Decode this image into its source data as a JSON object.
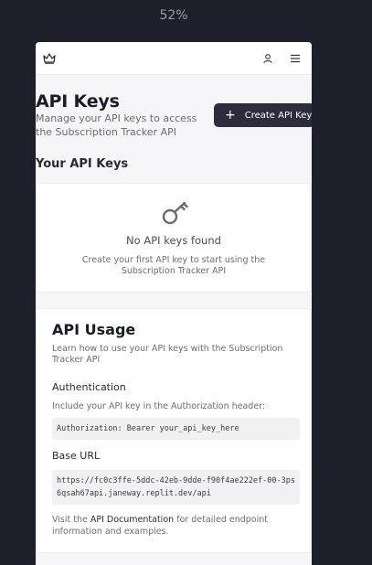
{
  "zoom": "52%",
  "page": {
    "title": "API Keys",
    "subtitle": "Manage your API keys to access the Subscription Tracker API",
    "create_button": "Create API Key"
  },
  "your_keys": {
    "heading": "Your API Keys",
    "empty_title": "No API keys found",
    "empty_desc": "Create your first API key to start using the Subscription Tracker API"
  },
  "usage": {
    "title": "API Usage",
    "desc": "Learn how to use your API keys with the Subscription Tracker API",
    "auth_heading": "Authentication",
    "auth_desc": "Include your API key in the Authorization header:",
    "auth_code": "Authorization: Bearer your_api_key_here",
    "base_heading": "Base URL",
    "base_code": "https://fc0c3ffe-5ddc-42eb-9dde-f90f4ae222ef-00-3ps6qsah67api.janeway.replit.dev/api",
    "note_before": "Visit the ",
    "note_link": "API Documentation",
    "note_after": " for detailed endpoint information and examples."
  },
  "icons": {
    "logo": "crown-icon",
    "profile": "user-icon",
    "menu": "hamburger-menu-icon",
    "empty": "key-icon",
    "create": "plus-icon"
  },
  "colors": {
    "background": "#1f1e2b",
    "accent": "#2d2c3d"
  }
}
